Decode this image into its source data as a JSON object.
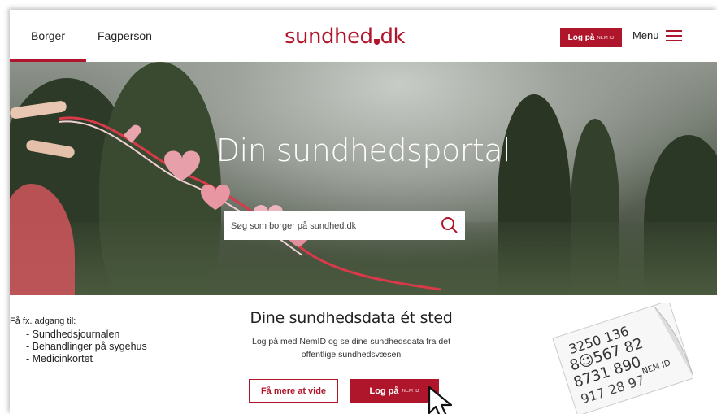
{
  "header": {
    "tabs": [
      {
        "label": "Borger",
        "active": true
      },
      {
        "label": "Fagperson",
        "active": false
      }
    ],
    "logo": {
      "text": "sundhed",
      "suffix": "dk"
    },
    "login_label": "Log på",
    "login_nemid": "NEM ID",
    "menu_label": "Menu"
  },
  "hero": {
    "title": "Din sundhedsportal",
    "search_placeholder": "Søg som borger på sundhed.dk"
  },
  "access": {
    "intro": "Få fx. adgang til:",
    "items": [
      "Sundhedsjournalen",
      "Behandlinger på sygehus",
      "Medicinkortet"
    ]
  },
  "data_section": {
    "title": "Dine sundhedsdata ét sted",
    "description_line1": "Log på med NemID og se dine sundhedsdata fra det",
    "description_line2": "offentlige sundhedsvæsen",
    "more_button": "Få mere at vide",
    "login_button": "Log på",
    "login_nemid": "NEM ID"
  },
  "card": {
    "label": "NEM ID"
  },
  "colors": {
    "brand": "#b0162b"
  }
}
